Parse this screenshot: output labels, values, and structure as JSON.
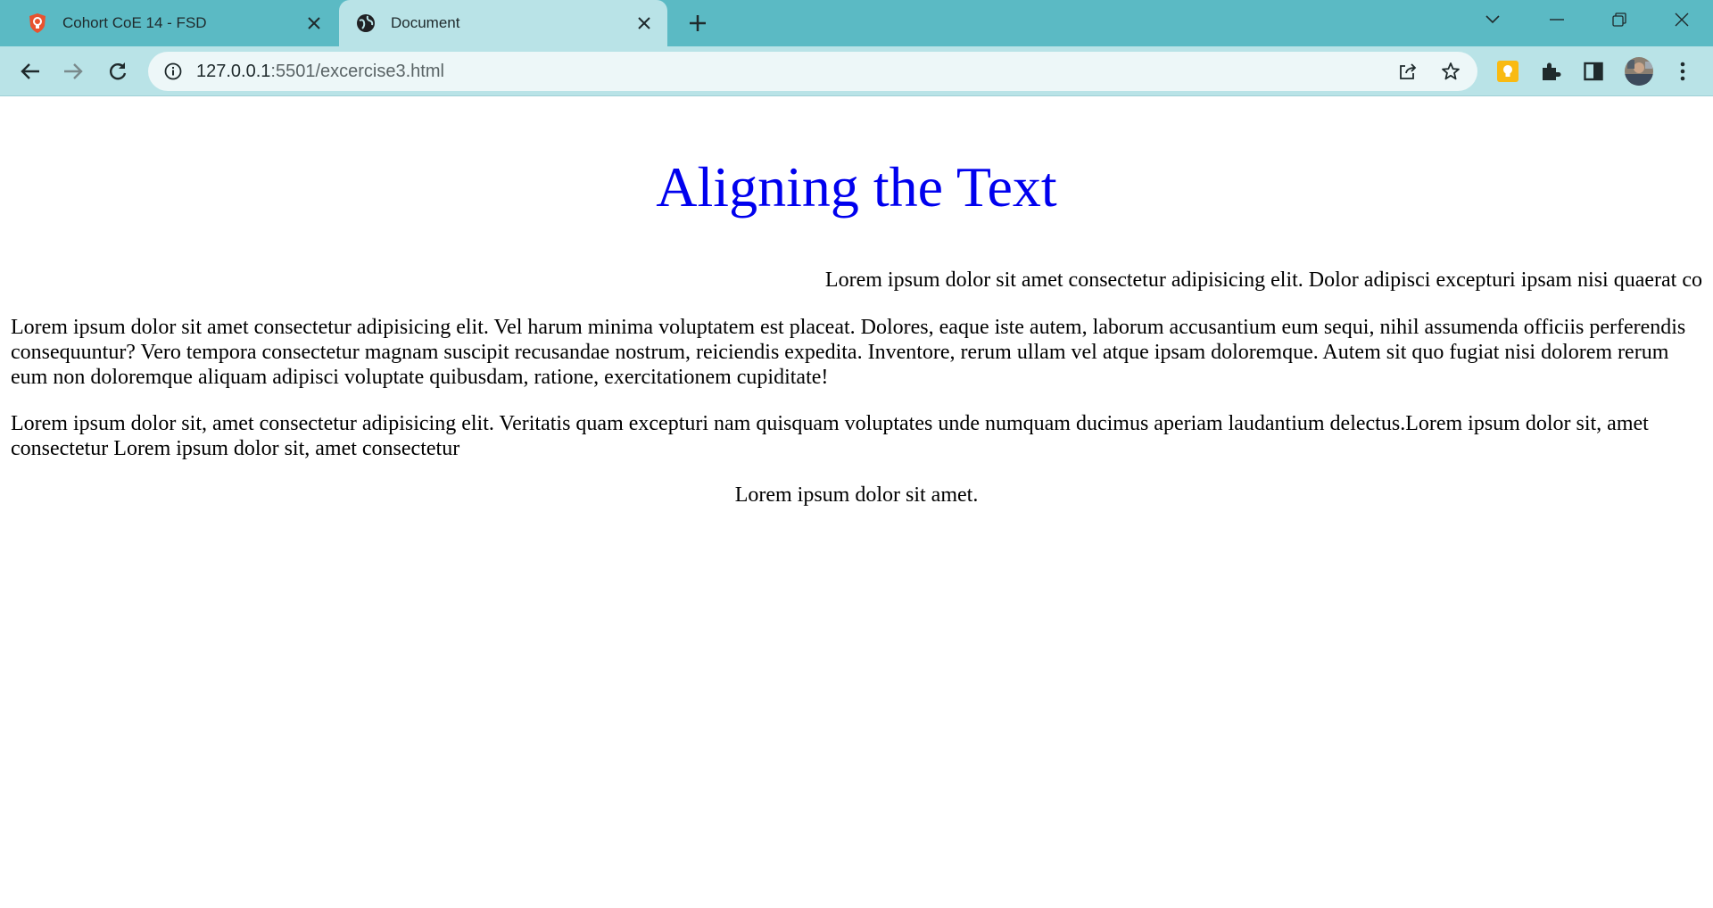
{
  "browser": {
    "tabs": [
      {
        "title": "Cohort CoE 14 - FSD",
        "favicon": "shield-favicon-icon",
        "active": false
      },
      {
        "title": "Document",
        "favicon": "globe-icon",
        "active": true
      }
    ],
    "address": {
      "host": "127.0.0.1",
      "path": ":5501/excercise3.html"
    },
    "colors": {
      "tabstrip": "#5bbac4",
      "toolbar": "#b9e3e7",
      "omnibox": "#edf7f8"
    }
  },
  "page": {
    "heading": "Aligning the Text",
    "heading_color": "#0000ee",
    "para_right": "Lorem ipsum dolor sit amet consectetur adipisicing elit. Dolor adipisci excepturi ipsam nisi quaerat co",
    "para_left1": "Lorem ipsum dolor sit amet consectetur adipisicing elit. Vel harum minima voluptatem est placeat. Dolores, eaque iste autem, laborum accusantium eum sequi, nihil assumenda officiis perferendis consequuntur? Vero tempora consectetur magnam suscipit recusandae nostrum, reiciendis expedita. Inventore, rerum ullam vel atque ipsam doloremque. Autem sit quo fugiat nisi dolorem rerum eum non doloremque aliquam adipisci voluptate quibusdam, ratione, exercitationem cupiditate!",
    "para_left2": "Lorem ipsum dolor sit, amet consectetur adipisicing elit. Veritatis quam excepturi nam quisquam voluptates unde numquam ducimus aperiam laudantium delectus.Lorem ipsum dolor sit, amet consectetur Lorem ipsum dolor sit, amet consectetur",
    "para_center": "Lorem ipsum dolor sit amet."
  }
}
